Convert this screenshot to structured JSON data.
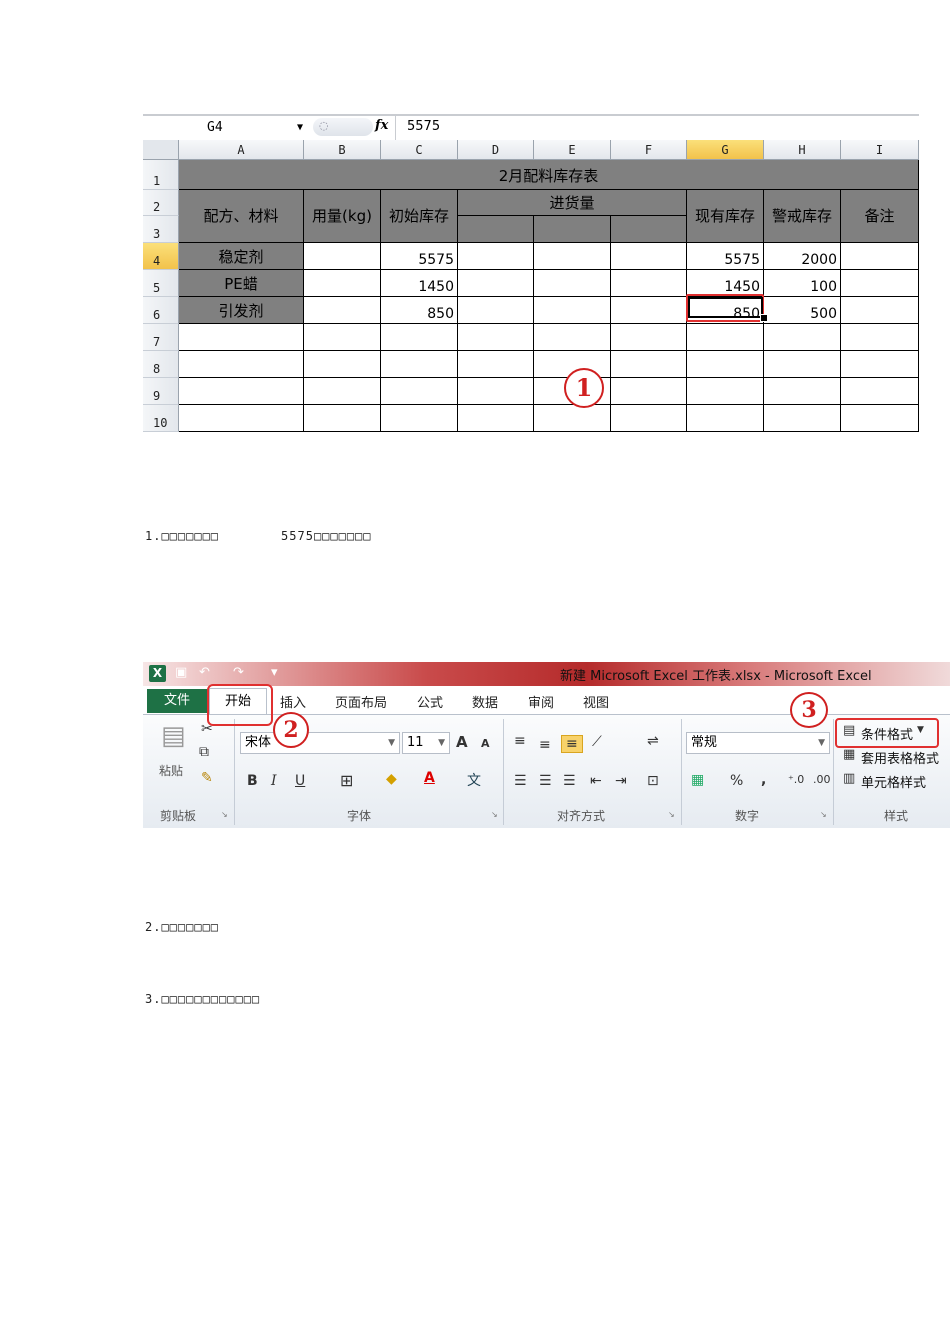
{
  "sheet": {
    "name_box": "G4",
    "formula_value": "5575",
    "columns": [
      "A",
      "B",
      "C",
      "D",
      "E",
      "F",
      "G",
      "H",
      "I"
    ],
    "selected_column": "G",
    "rows": [
      "1",
      "2",
      "3",
      "4",
      "5",
      "6",
      "7",
      "8",
      "9",
      "10"
    ],
    "selected_row": "4",
    "title": "2月配料库存表",
    "headers": {
      "material": "配方、材料",
      "usage": "用量(kg)",
      "initial_stock": "初始库存",
      "incoming": "进货量",
      "current_stock": "现有库存",
      "warning_stock": "警戒库存",
      "note": "备注"
    },
    "data_rows": [
      {
        "material": "稳定剂",
        "initial": "5575",
        "current": "5575",
        "warning": "2000"
      },
      {
        "material": "PE蜡",
        "initial": "1450",
        "current": "1450",
        "warning": "100"
      },
      {
        "material": "引发剂",
        "initial": "850",
        "current": "850",
        "warning": "500"
      }
    ]
  },
  "callouts": {
    "one": "1",
    "two": "2",
    "three": "3"
  },
  "captions": {
    "step1_prefix": "1.□□□□□□□",
    "step1_value": "5575",
    "step1_suffix": "□□□□□□□",
    "step2": "2.□□□□□□□",
    "step3": "3.□□□□□□□□□□□□"
  },
  "ribbon": {
    "window_title": "新建 Microsoft Excel 工作表.xlsx  -  Microsoft Excel",
    "tabs": {
      "file": "文件",
      "home": "开始",
      "insert": "插入",
      "page_layout": "页面布局",
      "formulas": "公式",
      "data": "数据",
      "review": "审阅",
      "view": "视图"
    },
    "clipboard": {
      "paste": "粘贴",
      "label": "剪贴板"
    },
    "font": {
      "name": "宋体",
      "size": "11",
      "label": "字体"
    },
    "alignment": {
      "label": "对齐方式"
    },
    "number": {
      "format": "常规",
      "percent": "%",
      "comma": ",",
      "label": "数字"
    },
    "styles": {
      "conditional_formatting": "条件格式",
      "format_as_table": "套用表格格式",
      "cell_styles": "单元格样式",
      "label": "样式"
    }
  }
}
